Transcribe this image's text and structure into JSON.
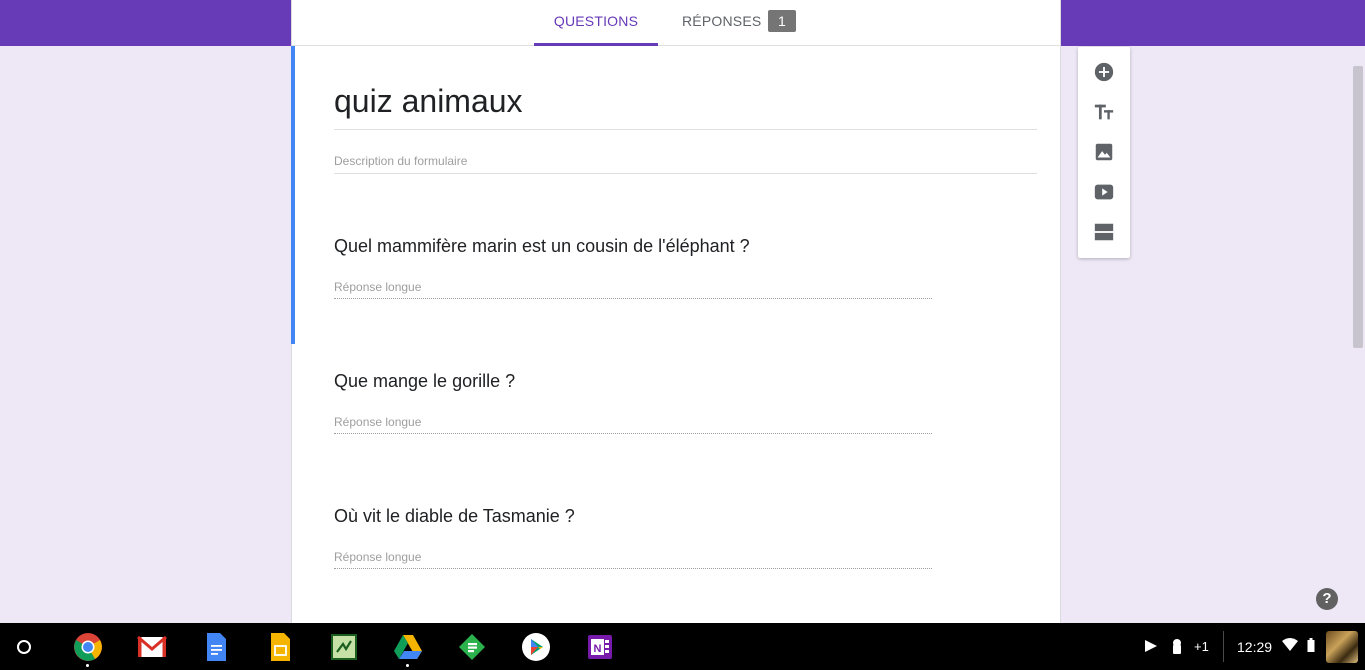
{
  "tabs": {
    "questions": "QUESTIONS",
    "responses": "RÉPONSES",
    "responses_count": "1"
  },
  "form": {
    "title": "quiz animaux",
    "description_placeholder": "Description du formulaire"
  },
  "questions": [
    {
      "title": "Quel mammifère marin est un cousin de l'éléphant ?",
      "answer_placeholder": "Réponse longue"
    },
    {
      "title": "Que mange le gorille ?",
      "answer_placeholder": "Réponse longue"
    },
    {
      "title": "Où vit le diable de Tasmanie ?",
      "answer_placeholder": "Réponse longue"
    }
  ],
  "toolbar": {
    "icons": [
      "add-question-icon",
      "add-title-icon",
      "add-image-icon",
      "add-video-icon",
      "add-section-icon"
    ]
  },
  "help": {
    "label": "?"
  },
  "shelf": {
    "apps": [
      "chrome-icon",
      "gmail-icon",
      "docs-icon",
      "slides-icon",
      "sheets-app-icon",
      "drive-icon",
      "feedly-icon",
      "play-store-icon",
      "onenote-icon"
    ],
    "tray": {
      "notifications_extra": "+1",
      "time": "12:29"
    }
  },
  "colors": {
    "header": "#673ab7",
    "background": "#ede7f6",
    "active_stripe": "#4285f4"
  }
}
